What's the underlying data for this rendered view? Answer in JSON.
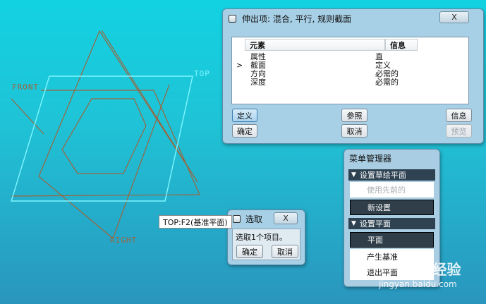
{
  "viewport": {
    "labels": {
      "front": "FRONT",
      "top": "TOP",
      "right": "RIGHT"
    },
    "colors": {
      "sketch": "#9a6640",
      "highlight": "#7ff6ff"
    }
  },
  "feature_dialog": {
    "title": "伸出项: 混合, 平行, 规则截面",
    "close_label": "X",
    "columns": [
      "元素",
      "信息"
    ],
    "rows": [
      {
        "marker": "",
        "element": "属性",
        "info": "直"
      },
      {
        "marker": ">",
        "element": "截面",
        "info": "定义"
      },
      {
        "marker": "",
        "element": "方向",
        "info": "必需的"
      },
      {
        "marker": "",
        "element": "深度",
        "info": "必需的"
      }
    ],
    "buttons": {
      "define": "定义",
      "reference": "参照",
      "info": "信息",
      "ok": "确定",
      "cancel": "取消",
      "preview": "预览"
    }
  },
  "menu_manager": {
    "title": "菜单管理器",
    "sections": [
      {
        "label": "设置草绘平面",
        "items": [
          {
            "label": "使用先前的",
            "state": "disabled"
          },
          {
            "label": "新设置",
            "state": "selected"
          }
        ]
      },
      {
        "label": "设置平面",
        "items": [
          {
            "label": "平面",
            "state": "selected"
          },
          {
            "label": "产生基准",
            "state": "normal"
          },
          {
            "label": "退出平面",
            "state": "normal"
          }
        ]
      }
    ]
  },
  "select_dialog": {
    "title": "选取",
    "close_label": "X",
    "message": "选取1个项目。",
    "ok": "确定",
    "cancel": "取消"
  },
  "tooltip": {
    "text": "TOP:F2(基准平面)"
  },
  "watermark": {
    "brand": "Bai 经验",
    "url": "jingyan.baidu.com"
  }
}
